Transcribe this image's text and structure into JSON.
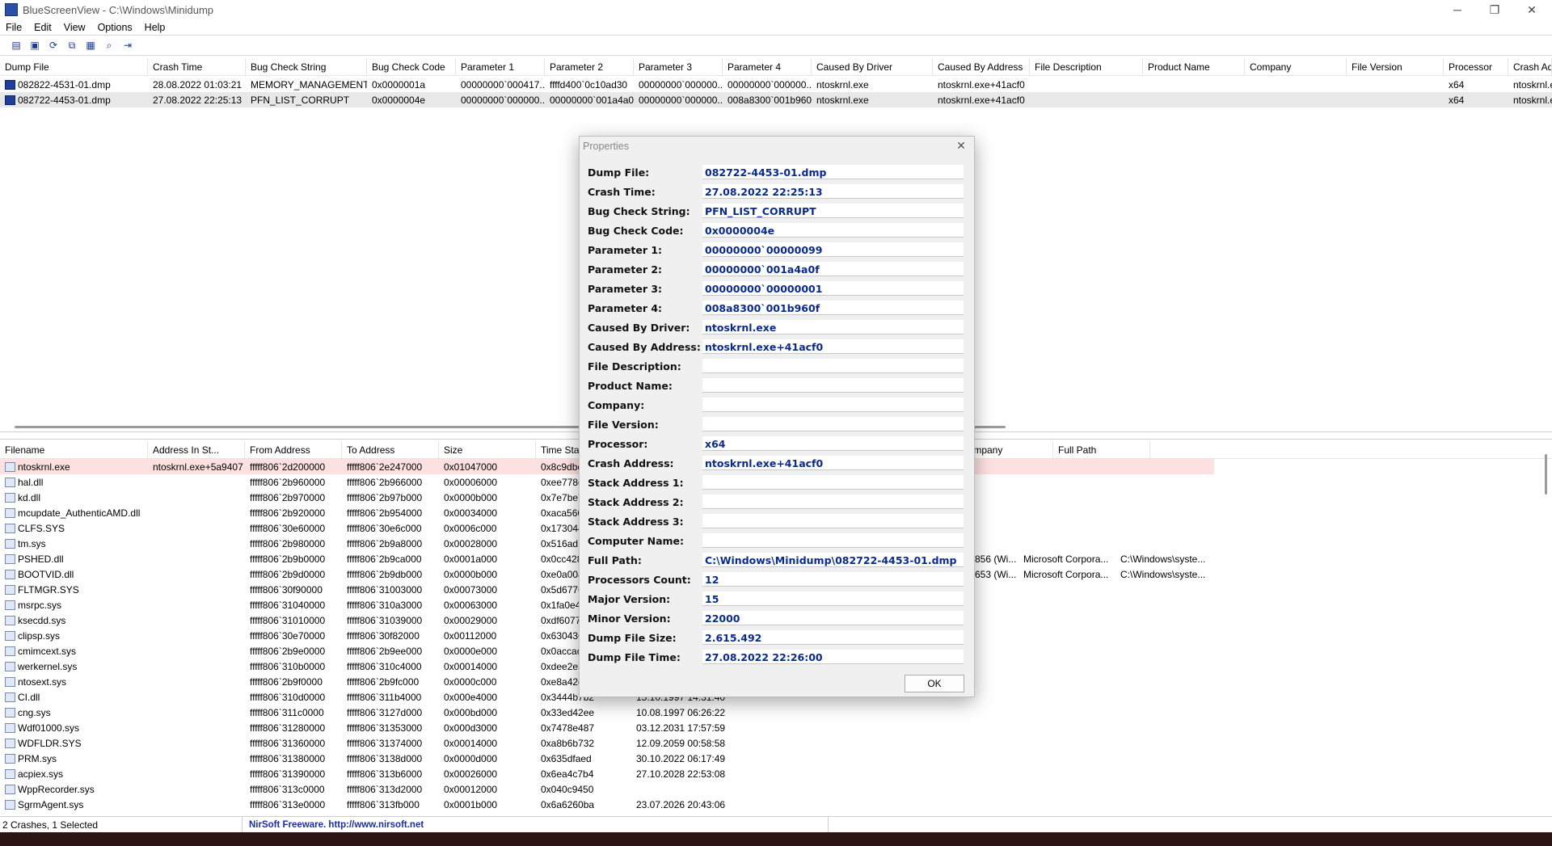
{
  "window": {
    "title": "BlueScreenView   -   C:\\Windows\\Minidump",
    "minimize_glyph": "─",
    "maximize_glyph": "❐",
    "close_glyph": "✕"
  },
  "menu": [
    "File",
    "Edit",
    "View",
    "Options",
    "Help"
  ],
  "toolbar": {
    "icons": [
      "properties-icon",
      "save-icon",
      "refresh-icon",
      "copy-icon",
      "html-report-icon",
      "find-icon",
      "exit-icon"
    ],
    "glyphs": [
      "▤",
      "▣",
      "⟳",
      "⧉",
      "▦",
      "⌕",
      "⇥"
    ]
  },
  "crash_list": {
    "columns": [
      "Dump File",
      "Crash Time",
      "Bug Check String",
      "Bug Check Code",
      "Parameter 1",
      "Parameter 2",
      "Parameter 3",
      "Parameter 4",
      "Caused By Driver",
      "Caused By Address",
      "File Description",
      "Product Name",
      "Company",
      "File Version",
      "Processor",
      "Crash Add"
    ],
    "sort_glyph": "▽",
    "rows": [
      [
        "082822-4531-01.dmp",
        "28.08.2022 01:03:21",
        "MEMORY_MANAGEMENT",
        "0x0000001a",
        "00000000`000417...",
        "ffffd400`0c10ad30",
        "00000000`000000...",
        "00000000`000000...",
        "ntoskrnl.exe",
        "ntoskrnl.exe+41acf0",
        "",
        "",
        "",
        "",
        "x64",
        "ntoskrnl.e"
      ],
      [
        "082722-4453-01.dmp",
        "27.08.2022 22:25:13",
        "PFN_LIST_CORRUPT",
        "0x0000004e",
        "00000000`000000...",
        "00000000`001a4a0f",
        "00000000`000000...",
        "008a8300`001b960f",
        "ntoskrnl.exe",
        "ntoskrnl.exe+41acf0",
        "",
        "",
        "",
        "",
        "x64",
        "ntoskrnl.e"
      ]
    ]
  },
  "driver_list": {
    "columns": [
      "Filename",
      "Address In St...",
      "From Address",
      "To Address",
      "Size",
      "Time Stan"
    ],
    "right_columns": [
      "Company",
      "Full Path"
    ],
    "sort_glyph": "/",
    "rows": [
      [
        "ntoskrnl.exe",
        "ntoskrnl.exe+5a9407",
        "fffff806`2d200000",
        "fffff806`2e247000",
        "0x01047000",
        "0x8c9dbe"
      ],
      [
        "hal.dll",
        "",
        "fffff806`2b960000",
        "fffff806`2b966000",
        "0x00006000",
        "0xee778d"
      ],
      [
        "kd.dll",
        "",
        "fffff806`2b970000",
        "fffff806`2b97b000",
        "0x0000b000",
        "0x7e7be7"
      ],
      [
        "mcupdate_AuthenticAMD.dll",
        "",
        "fffff806`2b920000",
        "fffff806`2b954000",
        "0x00034000",
        "0xaca566"
      ],
      [
        "CLFS.SYS",
        "",
        "fffff806`30e60000",
        "fffff806`30e6c000",
        "0x0006c000",
        "0x173044"
      ],
      [
        "tm.sys",
        "",
        "fffff806`2b980000",
        "fffff806`2b9a8000",
        "0x00028000",
        "0x516ad1"
      ],
      [
        "PSHED.dll",
        "",
        "fffff806`2b9b0000",
        "fffff806`2b9ca000",
        "0x0001a000",
        "0x0cc428"
      ],
      [
        "BOOTVID.dll",
        "",
        "fffff806`2b9d0000",
        "fffff806`2b9db000",
        "0x0000b000",
        "0xe0a00a"
      ],
      [
        "FLTMGR.SYS",
        "",
        "fffff806`30f90000",
        "fffff806`31003000",
        "0x00073000",
        "0x5d6776"
      ],
      [
        "msrpc.sys",
        "",
        "fffff806`31040000",
        "fffff806`310a3000",
        "0x00063000",
        "0x1fa0e4"
      ],
      [
        "ksecdd.sys",
        "",
        "fffff806`31010000",
        "fffff806`31039000",
        "0x00029000",
        "0xdf6077"
      ],
      [
        "clipsp.sys",
        "",
        "fffff806`30e70000",
        "fffff806`30f82000",
        "0x00112000",
        "0x630436"
      ],
      [
        "cmimcext.sys",
        "",
        "fffff806`2b9e0000",
        "fffff806`2b9ee000",
        "0x0000e000",
        "0x0accac"
      ],
      [
        "werkernel.sys",
        "",
        "fffff806`310b0000",
        "fffff806`310c4000",
        "0x00014000",
        "0xdee2e3"
      ],
      [
        "ntosext.sys",
        "",
        "fffff806`2b9f0000",
        "fffff806`2b9fc000",
        "0x0000c000",
        "0xe8a42c"
      ],
      [
        "CI.dll",
        "",
        "fffff806`310d0000",
        "fffff806`311b4000",
        "0x000e4000",
        "0x3444b7b2"
      ],
      [
        "cng.sys",
        "",
        "fffff806`311c0000",
        "fffff806`3127d000",
        "0x000bd000",
        "0x33ed42ee"
      ],
      [
        "Wdf01000.sys",
        "",
        "fffff806`31280000",
        "fffff806`31353000",
        "0x000d3000",
        "0x7478e487"
      ],
      [
        "WDFLDR.SYS",
        "",
        "fffff806`31360000",
        "fffff806`31374000",
        "0x00014000",
        "0xa8b6b732"
      ],
      [
        "PRM.sys",
        "",
        "fffff806`31380000",
        "fffff806`3138d000",
        "0x0000d000",
        "0x635dfaed"
      ],
      [
        "acpiex.sys",
        "",
        "fffff806`31390000",
        "fffff806`313b6000",
        "0x00026000",
        "0x6ea4c7b4"
      ],
      [
        "WppRecorder.sys",
        "",
        "fffff806`313c0000",
        "fffff806`313d2000",
        "0x00012000",
        "0x040c9450"
      ],
      [
        "SgrmAgent.sys",
        "",
        "fffff806`313e0000",
        "fffff806`313fb000",
        "0x0001b000",
        "0x6a6260ba"
      ]
    ],
    "time_stamps": [
      {
        "row": 15,
        "text": "15.10.1997 14:31:40"
      },
      {
        "row": 16,
        "text": "10.08.1997 06:26:22"
      },
      {
        "row": 17,
        "text": "03.12.2031 17:57:59"
      },
      {
        "row": 18,
        "text": "12.09.2059 00:58:58"
      },
      {
        "row": 19,
        "text": "30.10.2022 06:17:49"
      },
      {
        "row": 20,
        "text": "27.10.2028 22:53:08"
      },
      {
        "row": 22,
        "text": "23.07.2026 20:43:06"
      }
    ],
    "right_rows": [
      {
        "row": 6,
        "ver": "856 (Wi...",
        "company": "Microsoft Corpora...",
        "path": "C:\\Windows\\syste..."
      },
      {
        "row": 7,
        "ver": "653 (Wi...",
        "company": "Microsoft Corpora...",
        "path": "C:\\Windows\\syste..."
      }
    ]
  },
  "properties": {
    "title": "Properties",
    "close_glyph": "✕",
    "ok_label": "OK",
    "fields": [
      {
        "label": "Dump File:",
        "value": "082722-4453-01.dmp"
      },
      {
        "label": "Crash Time:",
        "value": "27.08.2022 22:25:13"
      },
      {
        "label": "Bug Check String:",
        "value": "PFN_LIST_CORRUPT"
      },
      {
        "label": "Bug Check Code:",
        "value": "0x0000004e"
      },
      {
        "label": "Parameter 1:",
        "value": "00000000`00000099"
      },
      {
        "label": "Parameter 2:",
        "value": "00000000`001a4a0f"
      },
      {
        "label": "Parameter 3:",
        "value": "00000000`00000001"
      },
      {
        "label": "Parameter 4:",
        "value": "008a8300`001b960f"
      },
      {
        "label": "Caused By Driver:",
        "value": "ntoskrnl.exe"
      },
      {
        "label": "Caused By Address:",
        "value": "ntoskrnl.exe+41acf0"
      },
      {
        "label": "File Description:",
        "value": ""
      },
      {
        "label": "Product Name:",
        "value": ""
      },
      {
        "label": "Company:",
        "value": ""
      },
      {
        "label": "File Version:",
        "value": ""
      },
      {
        "label": "Processor:",
        "value": "x64"
      },
      {
        "label": "Crash Address:",
        "value": "ntoskrnl.exe+41acf0"
      },
      {
        "label": "Stack Address 1:",
        "value": ""
      },
      {
        "label": "Stack Address 2:",
        "value": ""
      },
      {
        "label": "Stack Address 3:",
        "value": ""
      },
      {
        "label": "Computer Name:",
        "value": ""
      },
      {
        "label": "Full Path:",
        "value": "C:\\Windows\\Minidump\\082722-4453-01.dmp"
      },
      {
        "label": "Processors Count:",
        "value": "12"
      },
      {
        "label": "Major Version:",
        "value": "15"
      },
      {
        "label": "Minor Version:",
        "value": "22000"
      },
      {
        "label": "Dump File Size:",
        "value": "2.615.492"
      },
      {
        "label": "Dump File Time:",
        "value": "27.08.2022 22:26:00"
      }
    ]
  },
  "status": {
    "count_text": "2 Crashes, 1 Selected",
    "link_text": "NirSoft Freeware.  http://www.nirsoft.net"
  },
  "colors": {
    "selected_row": "#e8e8e8",
    "highlight_row": "#fde1e1",
    "value_text": "#0a2a8c",
    "link": "#1a2fa0"
  }
}
